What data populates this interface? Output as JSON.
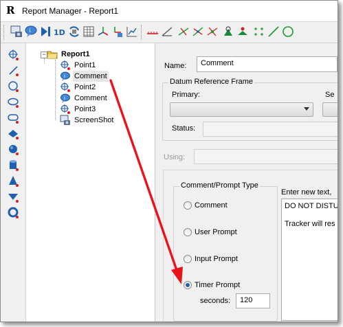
{
  "window": {
    "app_logo": "R",
    "title": "Report Manager - Report1"
  },
  "toolbar": {
    "icons": [
      "camera-icon",
      "comment-icon",
      "play-icon",
      "one-d-icon",
      "refresh-icon",
      "table-icon",
      "axis-icon",
      "move-icon",
      "chart-icon",
      "measure-icon",
      "angle-icon",
      "cross-icon",
      "intersect-icon",
      "angle-point-icon",
      "point-icon",
      "surface-icon",
      "grid-points-icon",
      "line-icon",
      "circle-icon"
    ],
    "one_d_label": "1D"
  },
  "left_tools": [
    "point-tool-icon",
    "line-tool-icon",
    "circle-tool-icon",
    "ellipse-tool-icon",
    "slot-tool-icon",
    "plane-tool-icon",
    "sphere-tool-icon",
    "cylinder-tool-icon",
    "cone-tool-icon",
    "paraboloid-tool-icon",
    "torus-tool-icon"
  ],
  "tree": {
    "root": "Report1",
    "items": [
      {
        "label": "Point1",
        "icon": "point-icon"
      },
      {
        "label": "Comment",
        "icon": "comment-icon",
        "selected": true
      },
      {
        "label": "Point2",
        "icon": "point-icon"
      },
      {
        "label": "Comment",
        "icon": "comment-icon"
      },
      {
        "label": "Point3",
        "icon": "point-icon"
      },
      {
        "label": "ScreenShot",
        "icon": "camera-icon"
      }
    ]
  },
  "panel": {
    "name_label": "Name:",
    "name_value": "Comment",
    "datum_group": "Datum Reference Frame",
    "primary_label": "Primary:",
    "secondary_label": "Se",
    "status_label": "Status:",
    "using_label": "Using:",
    "type_group": "Comment/Prompt Type",
    "options": [
      {
        "label": "Comment",
        "checked": false
      },
      {
        "label": "User Prompt",
        "checked": false
      },
      {
        "label": "Input Prompt",
        "checked": false
      },
      {
        "label": "Timer Prompt",
        "checked": true
      }
    ],
    "seconds_label": "seconds:",
    "seconds_value": "120",
    "text_label": "Enter new text,",
    "text_line1": "DO NOT DISTU",
    "text_line2": "Tracker will res"
  },
  "colors": {
    "annotation_arrow": "#e8141a",
    "radio_selected": "#1f5fb0"
  }
}
